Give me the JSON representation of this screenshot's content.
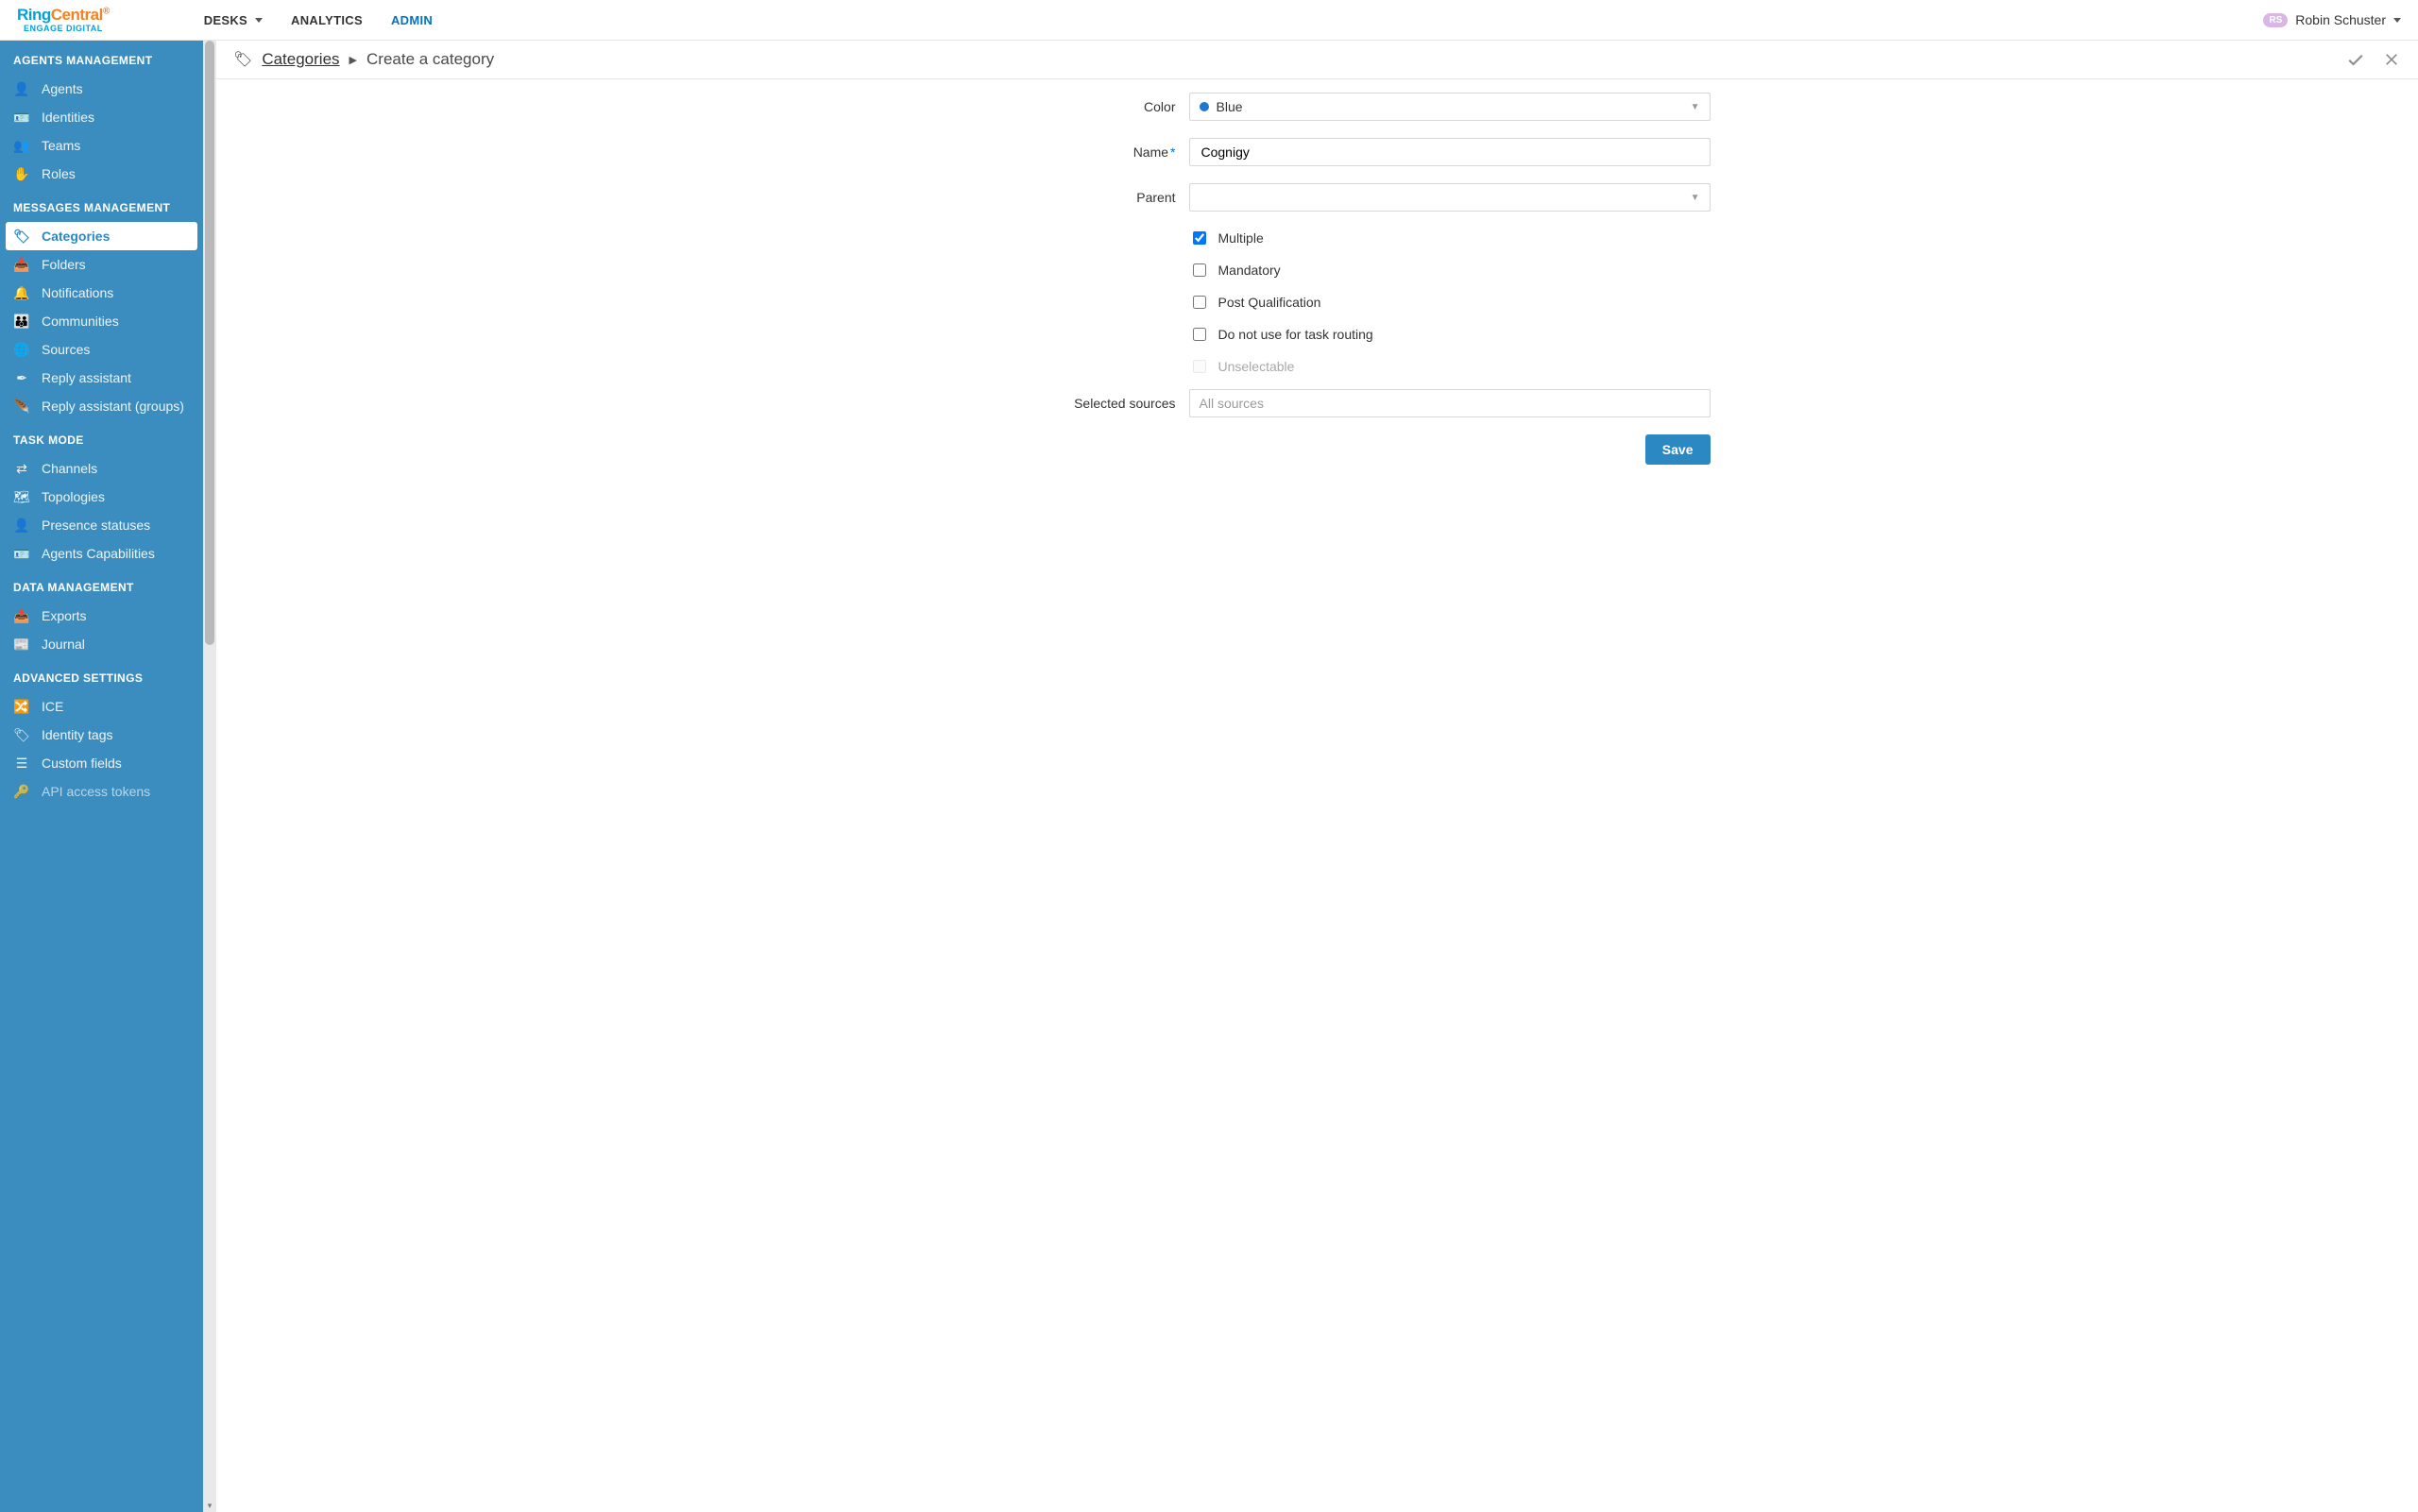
{
  "brand": {
    "main1": "Ring",
    "main2": "Central",
    "sub": "ENGAGE DIGITAL"
  },
  "topnav": {
    "desks": "DESKS",
    "analytics": "ANALYTICS",
    "admin": "ADMIN"
  },
  "user": {
    "initials": "RS",
    "name": "Robin Schuster"
  },
  "sidebar": {
    "s1": "AGENTS MANAGEMENT",
    "agents": "Agents",
    "identities": "Identities",
    "teams": "Teams",
    "roles": "Roles",
    "s2": "MESSAGES MANAGEMENT",
    "categories": "Categories",
    "folders": "Folders",
    "notifications": "Notifications",
    "communities": "Communities",
    "sources": "Sources",
    "reply": "Reply assistant",
    "reply_g": "Reply assistant (groups)",
    "s3": "TASK MODE",
    "channels": "Channels",
    "topologies": "Topologies",
    "presence": "Presence statuses",
    "agentcap": "Agents Capabilities",
    "s4": "DATA MANAGEMENT",
    "exports": "Exports",
    "journal": "Journal",
    "s5": "ADVANCED SETTINGS",
    "ice": "ICE",
    "idtags": "Identity tags",
    "custom": "Custom fields",
    "api": "API access tokens"
  },
  "breadcrumb": {
    "root": "Categories",
    "current": "Create a category"
  },
  "form": {
    "labels": {
      "color": "Color",
      "name": "Name",
      "parent": "Parent",
      "selected": "Selected sources"
    },
    "color_value": "Blue",
    "name_value": "Cognigy",
    "parent_value": "",
    "checks": {
      "multiple": "Multiple",
      "mandatory": "Mandatory",
      "postq": "Post Qualification",
      "noroute": "Do not use for task routing",
      "unselect": "Unselectable"
    },
    "selected_placeholder": "All sources",
    "save": "Save"
  }
}
